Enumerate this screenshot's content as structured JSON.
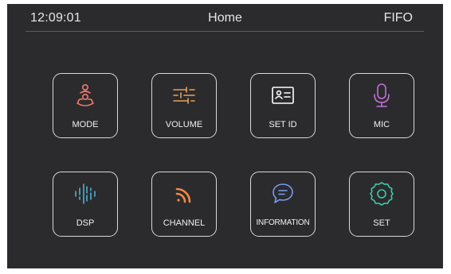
{
  "status_bar": {
    "time": "12:09:01",
    "title": "Home",
    "mode": "FIFO"
  },
  "tiles": [
    {
      "label": "MODE",
      "icon": "people-icon",
      "color": "#f07a70"
    },
    {
      "label": "VOLUME",
      "icon": "sliders-icon",
      "color": "#e8a258"
    },
    {
      "label": "SET ID",
      "icon": "id-card-icon",
      "color": "#ffffff"
    },
    {
      "label": "MIC",
      "icon": "microphone-icon",
      "color": "#c070d8"
    },
    {
      "label": "DSP",
      "icon": "sound-wave-icon",
      "color": "#4fb0d0"
    },
    {
      "label": "CHANNEL",
      "icon": "signal-icon",
      "color": "#f08a4a"
    },
    {
      "label": "INFORMATION",
      "icon": "chat-bubble-icon",
      "color": "#7a9cf0"
    },
    {
      "label": "SET",
      "icon": "gear-icon",
      "color": "#3fc8a8"
    }
  ]
}
